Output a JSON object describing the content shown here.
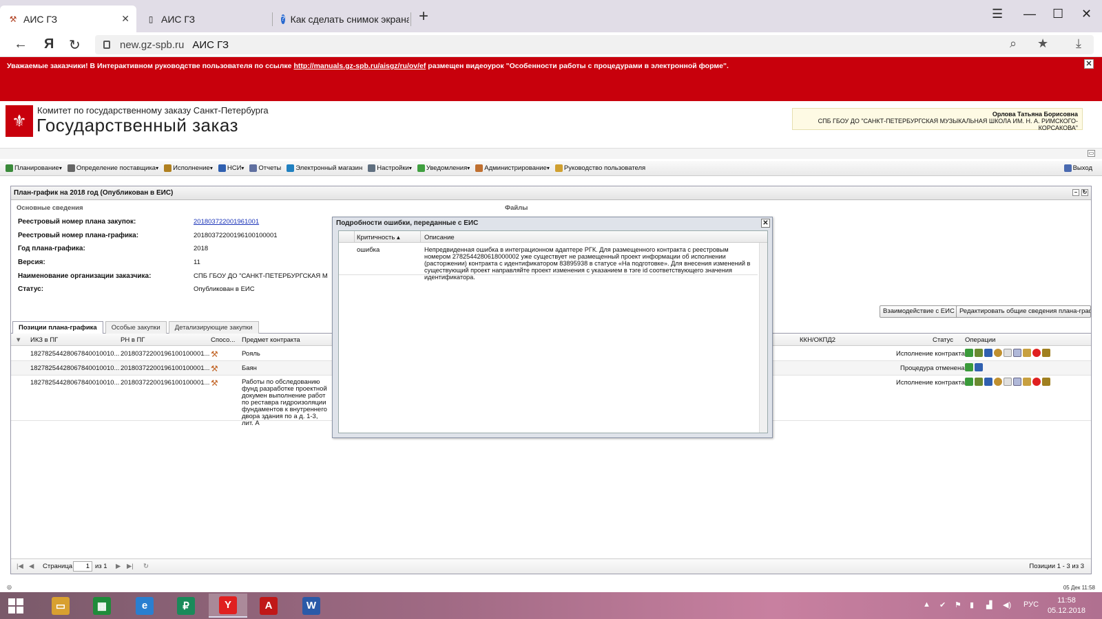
{
  "browser": {
    "tabs": [
      {
        "title": "АИС ГЗ",
        "icon": "gavel-icon"
      },
      {
        "title": "АИС ГЗ",
        "icon": "document-icon"
      },
      {
        "title": "Как сделать снимок экрана",
        "icon": "help-icon"
      }
    ],
    "new_tab": "+",
    "window_controls": {
      "menu": "☰",
      "minimize": "—",
      "maximize": "☐",
      "close": "✕"
    },
    "address": {
      "domain": "new.gz-spb.ru",
      "page_title": "АИС ГЗ"
    },
    "nav": {
      "back": "←",
      "yandex": "Я",
      "reload": "↻",
      "download": "⤓",
      "bookmark": "★"
    }
  },
  "notice": {
    "prefix": "Уважаемые заказчики! В Интерактивном руководстве пользователя по ссылке",
    "link": "http://manuals.gz-spb.ru/aisgz/ru/ov/ef",
    "suffix": "размещен видеоурок \"Особенности работы с процедурами в электронной форме\".",
    "close": "✕"
  },
  "header": {
    "org_line": "Комитет по государственному заказу Санкт-Петербурга",
    "product": "Государственный заказ",
    "user_name": "Орлова Татьяна Борисовна",
    "user_org": "СПБ ГБОУ ДО \"САНКТ-ПЕТЕРБУРГСКАЯ МУЗЫКАЛЬНАЯ ШКОЛА ИМ. Н. А. РИМСКОГО-КОРСАКОВА\""
  },
  "menu": {
    "items": [
      {
        "label": "Планирование",
        "dropdown": true,
        "color": "#3a8a3a"
      },
      {
        "label": "Определение поставщика",
        "dropdown": true,
        "color": "#666666"
      },
      {
        "label": "Исполнение",
        "dropdown": true,
        "color": "#b08020"
      },
      {
        "label": "НСИ",
        "dropdown": true,
        "color": "#3060b0"
      },
      {
        "label": "Отчеты",
        "dropdown": false,
        "color": "#6070a0"
      },
      {
        "label": "Электронный магазин",
        "dropdown": false,
        "color": "#2080c0"
      },
      {
        "label": "Настройки",
        "dropdown": true,
        "color": "#607080"
      },
      {
        "label": "Уведомления",
        "dropdown": true,
        "color": "#40a040"
      },
      {
        "label": "Администрирование",
        "dropdown": true,
        "color": "#c07030"
      },
      {
        "label": "Руководство пользователя",
        "dropdown": false,
        "color": "#d0a030"
      }
    ],
    "exit": "Выход"
  },
  "panel": {
    "title": "План-график на 2018 год (Опубликован в ЕИС)",
    "section_info": "Основные сведения",
    "section_files": "Файлы",
    "fields": [
      {
        "label": "Реестровый номер плана закупок:",
        "value": "201803722001961001",
        "link": true
      },
      {
        "label": "Реестровый номер плана-графика:",
        "value": "20180372200196100100001",
        "link": false
      },
      {
        "label": "Год плана-графика:",
        "value": "2018",
        "link": false
      },
      {
        "label": "Версия:",
        "value": "11",
        "link": false
      },
      {
        "label": "Наименование организации заказчика:",
        "value": "СПБ ГБОУ ДО \"САНКТ-ПЕТЕРБУРГСКАЯ МУЗЫ",
        "link": false
      },
      {
        "label": "Статус:",
        "value": "Опубликован в ЕИС",
        "link": false
      }
    ],
    "btn_interaction": "Взаимодействие с ЕИС",
    "btn_edit": "Редактировать общие сведения плана-графика",
    "tabs": [
      "Позиции плана-графика",
      "Особые закупки",
      "Детализирующие закупки"
    ],
    "grid": {
      "columns": {
        "ikz": "ИКЗ в ПГ",
        "rn": "РН в ПГ",
        "method": "Спосо...",
        "subject": "Предмет контракта",
        "kkn": "ККН/ОКПД2",
        "status": "Статус",
        "ops": "Операции"
      },
      "rows": [
        {
          "ikz": "18278254428067840010010...",
          "rn": "20180372200196100100001...",
          "subject": "Рояль",
          "status": "Исполнение контракта"
        },
        {
          "ikz": "18278254428067840010010...",
          "rn": "20180372200196100100001...",
          "subject": "Баян",
          "status": "Процедура отменена"
        },
        {
          "ikz": "18278254428067840010010...",
          "rn": "20180372200196100100001...",
          "subject": "Работы по обследованию фунд разработке проектной докумен выполнение работ по реставра гидроизоляции фундаментов к внутреннего двора здания по а д. 1-3, лит. А",
          "status": "Исполнение контракта"
        }
      ]
    },
    "pager": {
      "page_label": "Страница",
      "page": "1",
      "of": "из 1",
      "summary": "Позиции 1 - 3 из 3"
    }
  },
  "modal": {
    "title": "Подробности ошибки, переданные с ЕИС",
    "col_severity": "Критичность",
    "col_description": "Описание",
    "rows": [
      {
        "severity": "ошибка",
        "description": "Непредвиденная ошибка в интеграционном адаптере РГК. Для размещенного контракта с реестровым номером 2782544280618000002 уже существует не размещенный проект информации об исполнении (расторжении) контракта с идентификатором 83895938 в статусе «На подготовке». Для внесения изменений в существующий проект направляйте проект изменения с указанием в тэге id соответствующего значения идентификатора."
      }
    ]
  },
  "statusbar": {
    "datetime": "05 Дек 11:58"
  },
  "taskbar": {
    "apps": [
      {
        "name": "file-explorer",
        "color": "#d8a030",
        "glyph": "▭"
      },
      {
        "name": "spreadsheet",
        "color": "#1e8c3a",
        "glyph": "▦"
      },
      {
        "name": "internet-explorer",
        "color": "#2a7fd0",
        "glyph": "e"
      },
      {
        "name": "finance-app",
        "color": "#1a8a5a",
        "glyph": "₽"
      },
      {
        "name": "yandex-browser",
        "color": "#e02020",
        "glyph": "Y"
      },
      {
        "name": "pdf-reader",
        "color": "#c01818",
        "glyph": "A"
      },
      {
        "name": "word",
        "color": "#2b5aa8",
        "glyph": "W"
      }
    ],
    "lang": "РУС",
    "time": "11:58",
    "date": "05.12.2018"
  }
}
